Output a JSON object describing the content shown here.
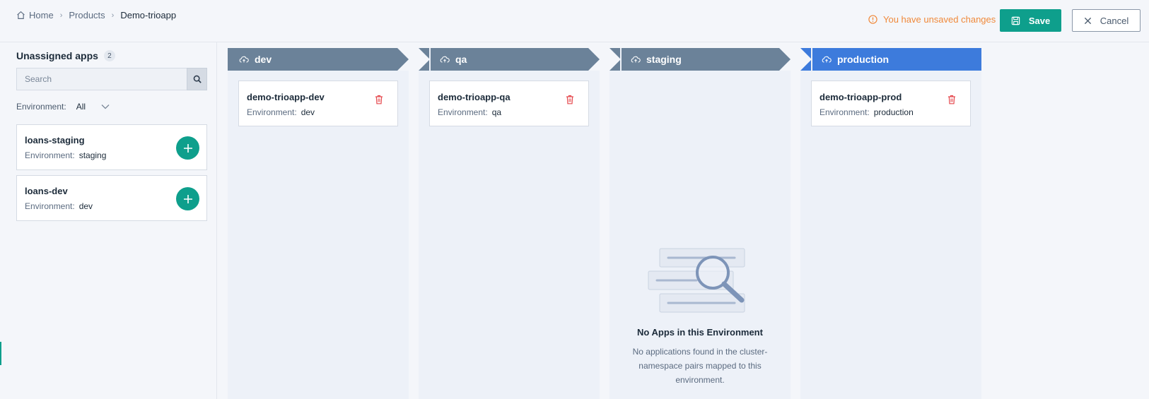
{
  "breadcrumb": {
    "home": "Home",
    "products": "Products",
    "current": "Demo-trioapp"
  },
  "header": {
    "unsaved_text": "You have unsaved changes",
    "save_label": "Save",
    "cancel_label": "Cancel"
  },
  "unassigned": {
    "title": "Unassigned apps",
    "count": "2",
    "search_placeholder": "Search",
    "env_filter_label": "Environment:",
    "env_filter_value": "All",
    "apps": [
      {
        "name": "loans-staging",
        "env_label": "Environment:",
        "env": "staging"
      },
      {
        "name": "loans-dev",
        "env_label": "Environment:",
        "env": "dev"
      }
    ]
  },
  "stages": [
    {
      "name": "dev",
      "active": false,
      "app": {
        "name": "demo-trioapp-dev",
        "env_label": "Environment:",
        "env": "dev"
      }
    },
    {
      "name": "qa",
      "active": false,
      "app": {
        "name": "demo-trioapp-qa",
        "env_label": "Environment:",
        "env": "qa"
      }
    },
    {
      "name": "staging",
      "active": false,
      "empty": {
        "title": "No Apps in this Environment",
        "description": "No applications found in the cluster-namespace pairs mapped to this environment."
      }
    },
    {
      "name": "production",
      "active": true,
      "app": {
        "name": "demo-trioapp-prod",
        "env_label": "Environment:",
        "env": "production"
      }
    }
  ],
  "colors": {
    "stage_header": "#6b8299",
    "stage_header_active": "#3d7bdc",
    "accent": "#0e9f8c",
    "warning": "#f0893a",
    "danger": "#e5484d"
  }
}
